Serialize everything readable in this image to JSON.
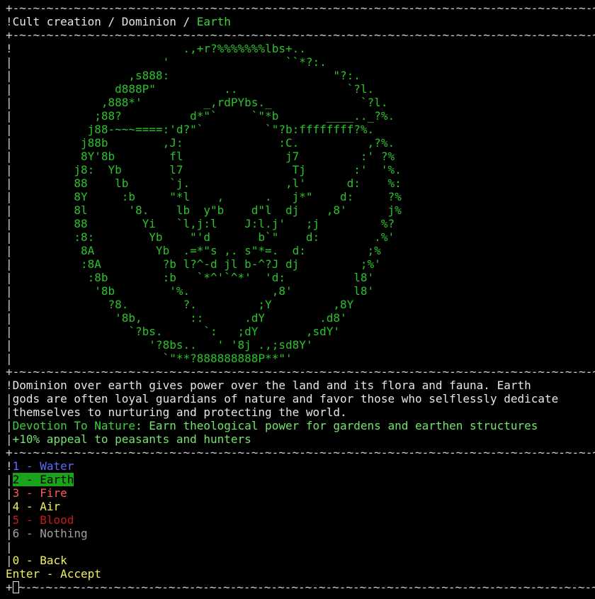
{
  "colors": {
    "green": "#3fd13f",
    "light_green": "#72e56c",
    "blue": "#5a6cff",
    "red": "#ff5a5a",
    "dark_red": "#c61c1c",
    "yellow": "#f0f060",
    "selection_bg": "#1aa31a"
  },
  "frame": {
    "border": "+-~-~-~-~-~-~-~-~-~-~-~-~-~-~-~-~-~-~-~-~-~-~-~-~-~-~-~-~-~-~-~-~-~-~-~-~-~-~-~-~-~-~-~-+"
  },
  "breadcrumb": {
    "prefix": "Cult creation / Dominion / ",
    "current": "Earth"
  },
  "art": [
    "                         .,+r?%%%%%%%lbs+..",
    "                      '                 ``*?:.",
    "                 ,s888:                        \"?:.",
    "               d888P\"          ..                `?l.",
    "             ,888*'         _,rdPYbs._             `?l.",
    "            ;88?          d*\"`     `\"*b       ____.._?%.",
    "           j88-~~~====:'d?\"`         `\"?b:ffffffff?%.",
    "          j88b        ,J:              :C.          ,?%.",
    "          8Y'8b        fl               j7         :' ?%",
    "         j8:  Yb       l7                Tj       :'  '%.",
    "         88    lb      `j.              ,l'      d:    %:",
    "         8Y     :b     \"*l    ,      .   j*\"    d:     ?%",
    "         8l      '8.    lb  y\"b    d\"l  dj    ,8'      j%",
    "         88        Yi   `l,j:l    J:l.j'   ;j         %?",
    "         :8:        Yb    \"'d       b`\"    d:        .%'",
    "          8A         Yb  .=*\"s ,. s\"*=.  d:         ;%",
    "          :8A         ?b l?^-d jl b-^?J dj         ;%'",
    "           :8b        :b   `*^'`^*'  'd:          l8'",
    "            '8b        '%.            ,8'         l8'",
    "              ?8.        ?.         ;Y         ,8Y",
    "               '8b,       ::      .dY        .d8'",
    "                 `?bs.      `:   ;dY       ,sdY'",
    "                    '?8bs..   ' '8j .,;sd8Y'",
    "                      `\"**?888888888P**\"'"
  ],
  "description": {
    "lines": [
      "Dominion over earth gives power over the land and its flora and fauna. Earth",
      "gods are often loyal guardians of nature and favor those who selflessly dedicate",
      "themselves to nurturing and protecting the world."
    ],
    "perk_name": "Devotion To Nature",
    "perk_separator": ": ",
    "perk_desc": "Earn theological power for gardens and earthen structures",
    "bonus": "+10% appeal to peasants and hunters"
  },
  "menu": {
    "options": [
      {
        "key": "1",
        "sep": " - ",
        "label": "Water"
      },
      {
        "key": "2",
        "sep": " - ",
        "label": "Earth"
      },
      {
        "key": "3",
        "sep": " - ",
        "label": "Fire"
      },
      {
        "key": "4",
        "sep": " - ",
        "label": "Air"
      },
      {
        "key": "5",
        "sep": " - ",
        "label": "Blood"
      },
      {
        "key": "6",
        "sep": " - ",
        "label": "Nothing"
      }
    ],
    "back": {
      "key": "0",
      "sep": " - ",
      "label": "Back"
    },
    "accept": {
      "key": "Enter",
      "sep": " - ",
      "label": "Accept"
    }
  }
}
